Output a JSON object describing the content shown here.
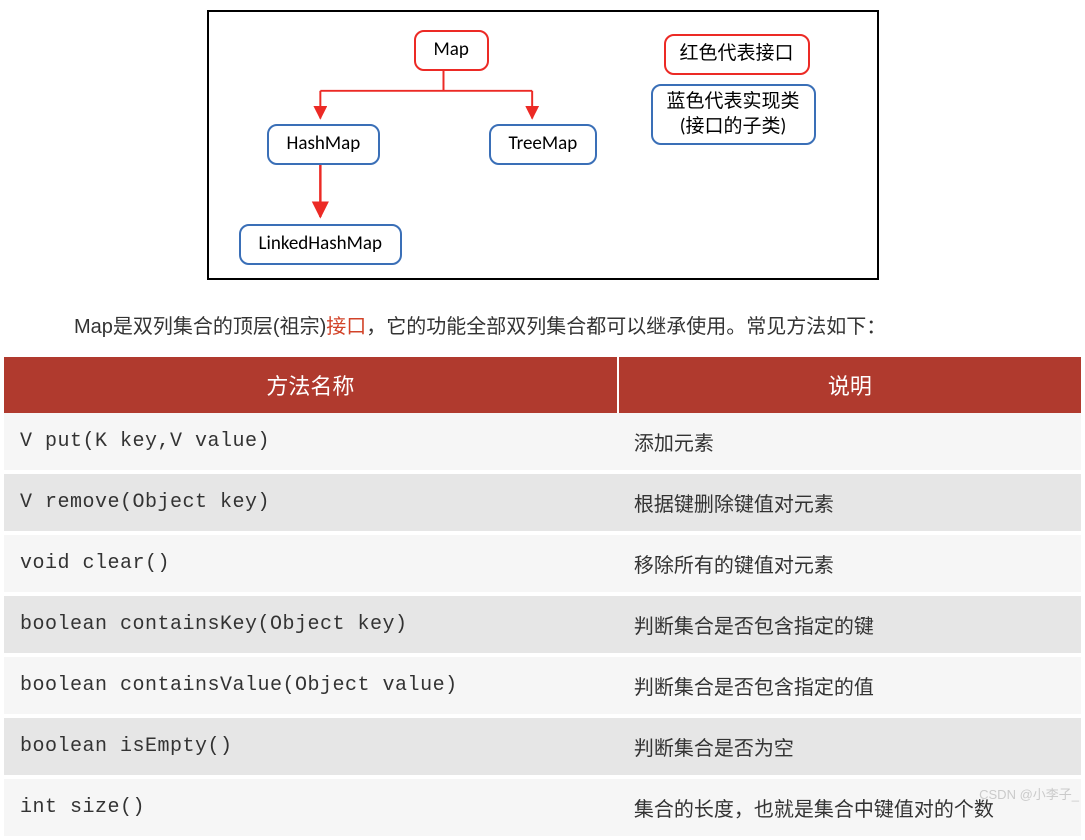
{
  "diagram": {
    "root": "Map",
    "hashmap": "HashMap",
    "treemap": "TreeMap",
    "linkedhashmap": "LinkedHashMap",
    "legend_interface": "红色代表接口",
    "legend_impl_line1": "蓝色代表实现类",
    "legend_impl_line2": "(接口的子类)"
  },
  "caption": {
    "before": "Map是双列集合的顶层(祖宗)",
    "highlight": "接口",
    "after": "，它的功能全部双列集合都可以继承使用。常见方法如下："
  },
  "table": {
    "header_method": "方法名称",
    "header_desc": "说明",
    "rows": [
      {
        "sig": "V put(K key,V value)",
        "desc": "添加元素"
      },
      {
        "sig": "V remove(Object key)",
        "desc": "根据键删除键值对元素"
      },
      {
        "sig": "void clear()",
        "desc": "移除所有的键值对元素"
      },
      {
        "sig": "boolean containsKey(Object key)",
        "desc": "判断集合是否包含指定的键"
      },
      {
        "sig": "boolean containsValue(Object value)",
        "desc": "判断集合是否包含指定的值"
      },
      {
        "sig": "boolean isEmpty()",
        "desc": "判断集合是否为空"
      },
      {
        "sig": "int size()",
        "desc": "集合的长度，也就是集合中键值对的个数"
      }
    ]
  },
  "watermark": "CSDN @小李子_"
}
